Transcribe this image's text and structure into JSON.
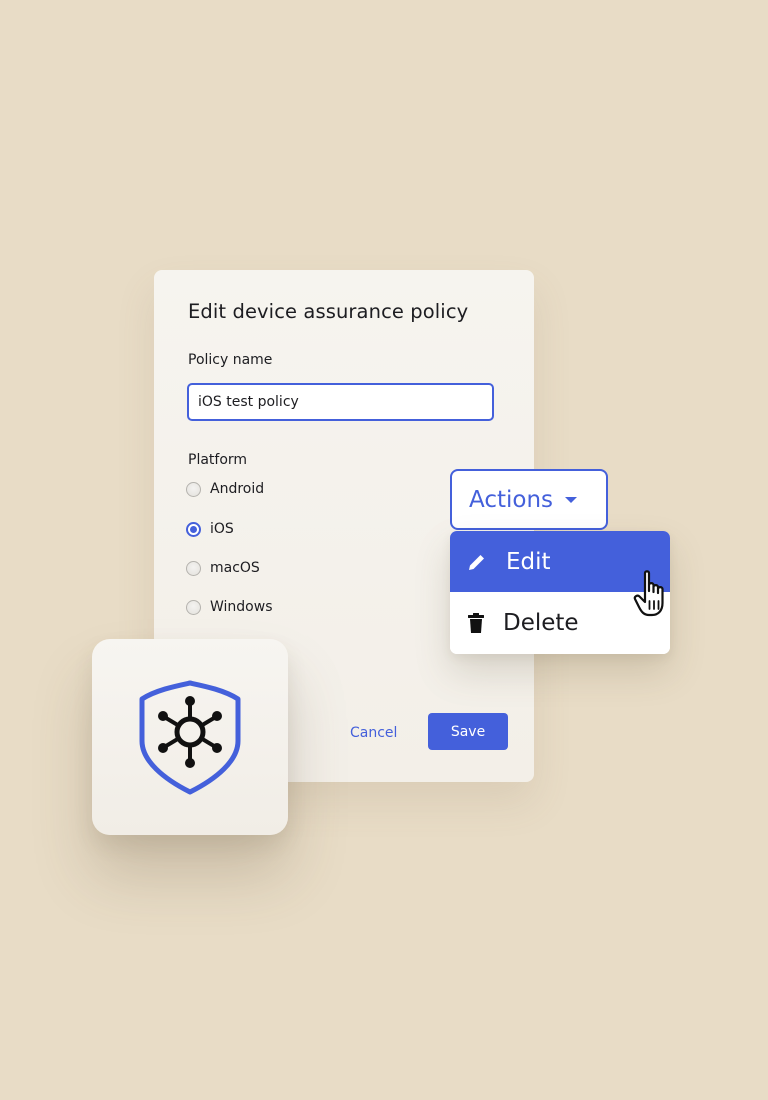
{
  "dialog": {
    "title": "Edit device assurance policy",
    "policy_name_label": "Policy name",
    "policy_name_value": "iOS test policy",
    "platform_label": "Platform",
    "platforms": [
      {
        "label": "Android",
        "selected": false
      },
      {
        "label": "iOS",
        "selected": true
      },
      {
        "label": "macOS",
        "selected": false
      },
      {
        "label": "Windows",
        "selected": false
      }
    ],
    "cancel_label": "Cancel",
    "save_label": "Save"
  },
  "actions": {
    "button_label": "Actions",
    "menu": [
      {
        "label": "Edit",
        "icon": "pencil-icon",
        "highlighted": true
      },
      {
        "label": "Delete",
        "icon": "trash-icon",
        "highlighted": false
      }
    ]
  },
  "app_icon": {
    "icon": "shield-network-icon"
  },
  "colors": {
    "background": "#e8dcc6",
    "accent": "#4460db",
    "card": "#f6f4ef",
    "text": "#1d1d21"
  }
}
